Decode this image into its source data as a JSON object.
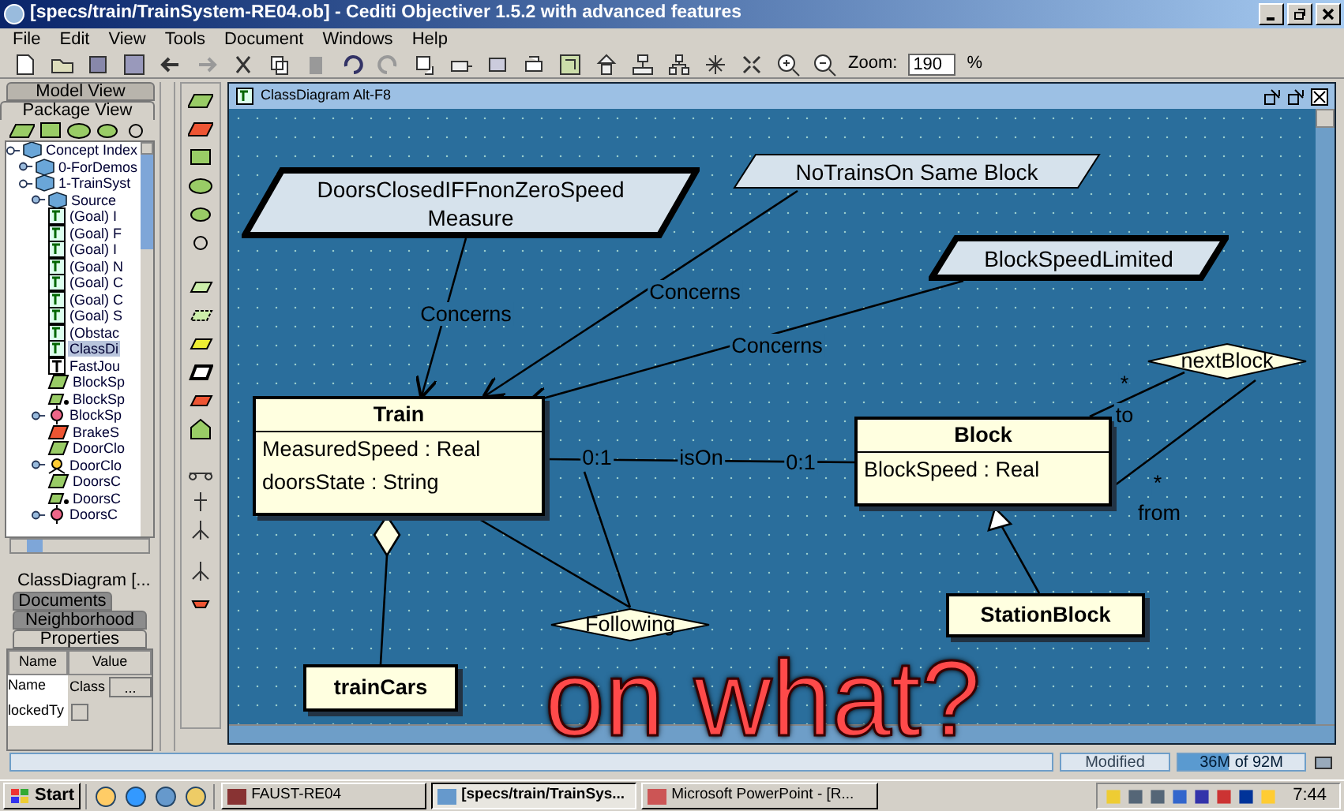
{
  "window": {
    "title": "[specs/train/TrainSystem-RE04.ob] - Cediti Objectiver 1.5.2 with advanced features"
  },
  "menu": [
    "File",
    "Edit",
    "View",
    "Tools",
    "Document",
    "Windows",
    "Help"
  ],
  "toolbar": {
    "zoom_label": "Zoom:",
    "zoom_value": "190",
    "zoom_unit": "%"
  },
  "left_tabs": [
    {
      "label": "Model View",
      "selected": false
    },
    {
      "label": "Package View",
      "selected": true
    }
  ],
  "tree": [
    {
      "label": "Concept Index",
      "kind": "package",
      "expanded": true,
      "children": [
        {
          "label": "0-ForDemos",
          "kind": "package",
          "expanded": false
        },
        {
          "label": "1-TrainSyst",
          "kind": "package",
          "expanded": true,
          "children": [
            {
              "label": "Source",
              "kind": "package",
              "expanded": false
            },
            {
              "label": "(Goal) I",
              "kind": "diagram"
            },
            {
              "label": "(Goal) F",
              "kind": "diagram"
            },
            {
              "label": "(Goal) I",
              "kind": "diagram"
            },
            {
              "label": "(Goal) N",
              "kind": "diagram"
            },
            {
              "label": "(Goal) C",
              "kind": "diagram"
            },
            {
              "label": "(Goal) C",
              "kind": "diagram"
            },
            {
              "label": "(Goal) S",
              "kind": "diagram"
            },
            {
              "label": "(Obstac",
              "kind": "diagram"
            },
            {
              "label": "ClassDi",
              "kind": "diagram",
              "selected": true
            },
            {
              "label": "FastJou",
              "kind": "text"
            },
            {
              "label": "BlockSp",
              "kind": "domain"
            },
            {
              "label": "BlockSp",
              "kind": "link"
            },
            {
              "label": "BlockSp",
              "kind": "agent",
              "expanded": false
            },
            {
              "label": "BrakeS",
              "kind": "requirement"
            },
            {
              "label": "DoorClo",
              "kind": "domain"
            },
            {
              "label": "DoorClo",
              "kind": "person",
              "expanded": false
            },
            {
              "label": "DoorsC",
              "kind": "domain"
            },
            {
              "label": "DoorsC",
              "kind": "link"
            },
            {
              "label": "DoorsC",
              "kind": "agent",
              "expanded": false
            }
          ]
        }
      ]
    }
  ],
  "current_item": "ClassDiagram  [...",
  "bottom_tabs": [
    {
      "label": "Documents",
      "selected": false
    },
    {
      "label": "Neighborhood",
      "selected": false
    },
    {
      "label": "Properties",
      "selected": true
    }
  ],
  "properties": {
    "columns": [
      "Name",
      "Value"
    ],
    "rows": [
      {
        "name": "Name",
        "value": "Class",
        "button": "..."
      },
      {
        "name": "lockedTy",
        "checked": false
      }
    ]
  },
  "diagram": {
    "title": "ClassDiagram  Alt-F8",
    "nodes": [
      {
        "kind": "domain",
        "thick": true,
        "lines": [
          "DoorsClosedIFFnonZeroSpeed",
          "Measure"
        ]
      },
      {
        "kind": "domain",
        "thick": false,
        "lines": [
          "NoTrainsOn Same Block"
        ]
      },
      {
        "kind": "domain",
        "thick": true,
        "lines": [
          "BlockSpeedLimited"
        ]
      },
      {
        "kind": "class",
        "name": "Train",
        "attributes": [
          "MeasuredSpeed : Real",
          "doorsState : String"
        ]
      },
      {
        "kind": "class",
        "name": "Block",
        "attributes": [
          "BlockSpeed : Real"
        ]
      },
      {
        "kind": "class",
        "name": "StationBlock"
      },
      {
        "kind": "class",
        "name": "trainCars"
      },
      {
        "kind": "association",
        "name": "nextBlock"
      },
      {
        "kind": "association",
        "name": "Following"
      }
    ],
    "edge_labels": [
      "Concerns",
      "Concerns",
      "Concerns",
      "0:1",
      "isOn",
      "0:1",
      "*",
      "to",
      "*",
      "from"
    ]
  },
  "annotation": "on what?",
  "status": {
    "modified": "Modified",
    "memory": "36M of 92M",
    "level": 0.4
  },
  "taskbar": {
    "start": "Start",
    "tasks": [
      {
        "label": "FAUST-RE04",
        "selected": false
      },
      {
        "label": "[specs/train/TrainSys...",
        "selected": true
      },
      {
        "label": "Microsoft PowerPoint - [R...",
        "selected": false
      }
    ],
    "clock": "7:44"
  }
}
